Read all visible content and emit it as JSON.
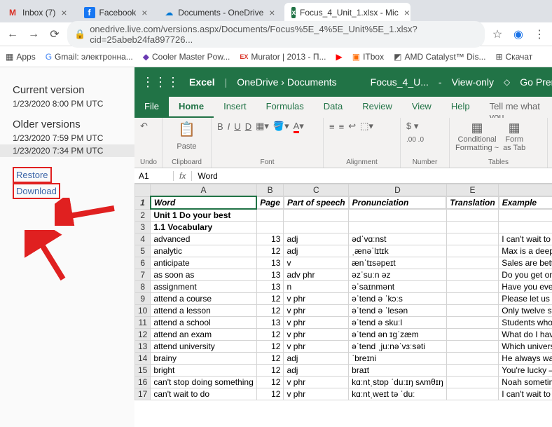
{
  "browser": {
    "tabs": [
      {
        "icon": "gmail",
        "label": "Inbox (7)"
      },
      {
        "icon": "fb",
        "label": "Facebook"
      },
      {
        "icon": "cloud",
        "label": "Documents - OneDrive"
      },
      {
        "icon": "xls",
        "label": "Focus_4_Unit_1.xlsx - Mic"
      }
    ],
    "url": "onedrive.live.com/versions.aspx/Documents/Focus%5E_4%5E_Unit%5E_1.xlsx?cid=25abeb24fa897726...",
    "bookmarks": [
      {
        "label": "Apps"
      },
      {
        "label": "Gmail: электронна..."
      },
      {
        "label": "Cooler Master Pow..."
      },
      {
        "label": "Murator | 2013 - П..."
      },
      {
        "label": ""
      },
      {
        "label": "ITbox"
      },
      {
        "label": "AMD Catalyst™ Dis..."
      },
      {
        "label": "Скачат"
      }
    ]
  },
  "sidebar": {
    "current_heading": "Current version",
    "current_ts": "1/23/2020 8:00 PM UTC",
    "older_heading": "Older versions",
    "older": [
      "1/23/2020 7:59 PM UTC",
      "1/23/2020 7:34 PM UTC"
    ],
    "restore": "Restore",
    "download": "Download"
  },
  "excel": {
    "app": "Excel",
    "breadcrumb1": "OneDrive",
    "breadcrumb2": "Documents",
    "filename": "Focus_4_U...",
    "mode": "View-only",
    "premium": "Go Premium",
    "tabs": {
      "file": "File",
      "home": "Home",
      "insert": "Insert",
      "formulas": "Formulas",
      "data": "Data",
      "review": "Review",
      "view": "View",
      "help": "Help",
      "tellme": "Tell me what you"
    },
    "ribbon": {
      "undo": "Undo",
      "clipboard": "Clipboard",
      "paste": "Paste",
      "font": "Font",
      "alignment": "Alignment",
      "number": "Number",
      "tables": "Tables",
      "cond": "Conditional",
      "cond2": "Formatting ~",
      "fmt": "Form",
      "fmt2": "as Tab"
    },
    "cellref": "A1",
    "fx": "fx",
    "cellval": "Word",
    "columns": [
      "A",
      "B",
      "C",
      "D",
      "E",
      "F"
    ],
    "headers": {
      "A": "Word",
      "B": "Page",
      "C": "Part of speech",
      "D": "Pronunciation",
      "E": "Translation",
      "F": "Example"
    },
    "rows": [
      {
        "n": 2,
        "A": "Unit 1 Do your best",
        "bold": true
      },
      {
        "n": 3,
        "A": "1.1 Vocabulary",
        "bold": true
      },
      {
        "n": 4,
        "A": "advanced",
        "B": "13",
        "C": "adj",
        "D": "ədˈvɑːnst",
        "F": "I can't wait to tackle some advanced Maths."
      },
      {
        "n": 5,
        "A": "analytic",
        "B": "12",
        "C": "adj",
        "D": "ˌænəˈlɪtɪk",
        "F": "Max is a deep thinker and an analytic learner."
      },
      {
        "n": 6,
        "A": "anticipate",
        "B": "13",
        "C": "v",
        "D": "ænˈtɪsəpeɪt",
        "F": "Sales are better than anticipated."
      },
      {
        "n": 7,
        "A": "as soon as",
        "B": "13",
        "C": "adv phr",
        "D": "əzˈsuːn əz",
        "F": "Do you get on with your homework as soon a"
      },
      {
        "n": 8,
        "A": "assignment",
        "B": "13",
        "C": "n",
        "D": "əˈsaɪnmənt",
        "F": "Have you ever finished an assignment and the"
      },
      {
        "n": 9,
        "A": "attend a course",
        "B": "12",
        "C": "v phr",
        "D": "əˈtend ə ˈkɔːs",
        "F": "Please let us know if you are unable to attend t"
      },
      {
        "n": 10,
        "A": "attend a lesson",
        "B": "12",
        "C": "v phr",
        "D": "əˈtend ə ˈlesən",
        "F": "Only twelve students attended the lesson."
      },
      {
        "n": 11,
        "A": "attend a school",
        "B": "13",
        "C": "v phr",
        "D": "əˈtend ə skuːl",
        "F": "Students who have a gift for drama should atte"
      },
      {
        "n": 12,
        "A": "attend an exam",
        "B": "12",
        "C": "v phr",
        "D": "əˈtend ən ɪɡˈzæm",
        "F": "What do I have to I do if I am unable to attend"
      },
      {
        "n": 13,
        "A": "attend university",
        "B": "12",
        "C": "v phr",
        "D": "əˈtend ˌjuːnəˈvɜːsəti",
        "F": "Which university would you most like to atten"
      },
      {
        "n": 14,
        "A": "brainy",
        "B": "12",
        "C": "adj",
        "D": "ˈbreɪni",
        "F": "He always was the brainy one."
      },
      {
        "n": 15,
        "A": "bright",
        "B": "12",
        "C": "adj",
        "D": "braɪt",
        "F": "You're lucky – you're naturally bright."
      },
      {
        "n": 16,
        "A": "can't stop doing something",
        "B": "12",
        "C": "v phr",
        "D": "kɑːntˌstɒp ˈduːɪŋ sʌmθɪŋ",
        "F": "Noah sometimes gets into trouble in class beca"
      },
      {
        "n": 17,
        "A": "can't wait to do",
        "B": "12",
        "C": "v phr",
        "D": "kɑːntˌweɪt tə ˈduː",
        "F": "I can't wait to see old classmates again."
      }
    ]
  }
}
